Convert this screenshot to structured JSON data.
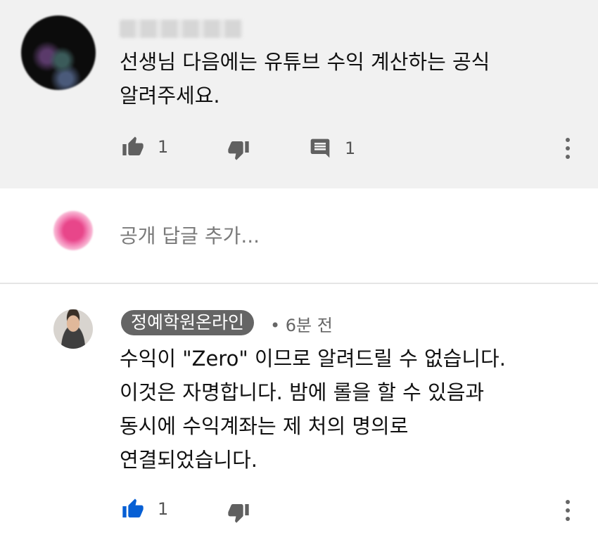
{
  "first_comment": {
    "text": "선생님 다음에는 유튜브 수익 계산하는 공식\n알려주세요.",
    "like_count": "1",
    "reply_count": "1"
  },
  "reply_box": {
    "placeholder": "공개 답글 추가..."
  },
  "reply": {
    "author": "정예학원온라인",
    "time": "• 6분 전",
    "text": "수익이 \"Zero\" 이므로 알려드릴 수 없습니다.\n이것은 자명합니다. 밤에 롤을 할 수 있음과\n동시에 수익계좌는 제 처의 명의로\n연결되었습니다.",
    "like_count": "1"
  },
  "colors": {
    "liked": "#065fd4",
    "icon": "#606060",
    "badge": "#656565"
  },
  "icons": [
    "thumb-up-icon",
    "thumb-down-icon",
    "comment-icon",
    "more-vert-icon"
  ]
}
